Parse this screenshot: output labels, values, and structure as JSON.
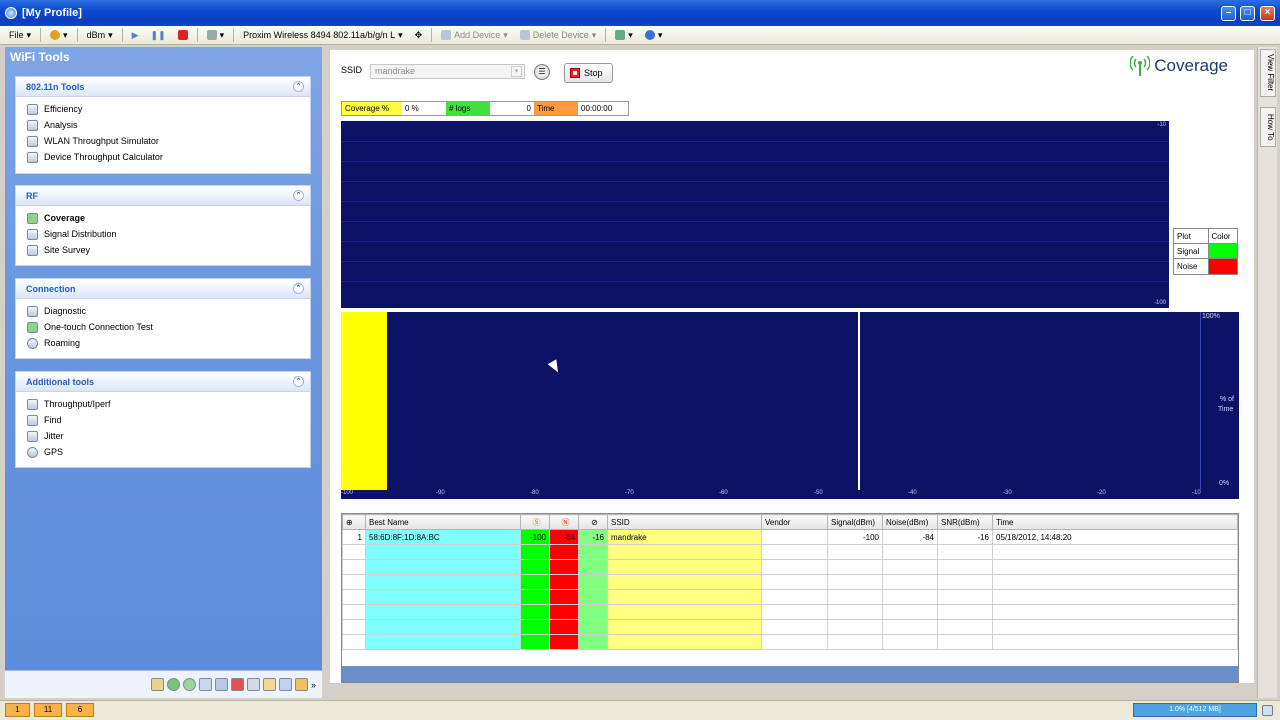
{
  "window": {
    "title": "[My Profile]"
  },
  "toolbar": {
    "file": "File",
    "unit": "dBm",
    "adapter": "Proxim Wireless 8494 802.11a/b/g/n L",
    "add_device": "Add Device",
    "delete_device": "Delete Device"
  },
  "leftpanel": {
    "title": "WiFi Tools",
    "groups": [
      {
        "title": "802.11n Tools",
        "items": [
          "Efficiency",
          "Analysis",
          "WLAN Throughput Simulator",
          "Device Throughput Calculator"
        ]
      },
      {
        "title": "RF",
        "items": [
          "Coverage",
          "Signal Distribution",
          "Site Survey"
        ]
      },
      {
        "title": "Connection",
        "items": [
          "Diagnostic",
          "One-touch Connection Test",
          "Roaming"
        ]
      },
      {
        "title": "Additional tools",
        "items": [
          "Throughput/Iperf",
          "Find",
          "Jitter",
          "GPS"
        ]
      }
    ]
  },
  "main": {
    "ssid_label": "SSID",
    "ssid_value": "mandrake",
    "stop_label": "Stop",
    "page_title": "Coverage",
    "status": {
      "coverage_label": "Coverage %",
      "coverage_value": "0 %",
      "logs_label": "# logs",
      "logs_value": "0",
      "time_label": "Time",
      "time_value": "00:00:00"
    },
    "plot1": {
      "y_top": "-10",
      "y_bottom": "-100"
    },
    "legend": {
      "header_plot": "Plot",
      "header_color": "Color",
      "rows": [
        {
          "name": "Signal",
          "color": "#00ff00"
        },
        {
          "name": "Noise",
          "color": "#ff0000"
        }
      ]
    },
    "plot2": {
      "x_ticks": [
        "-100",
        "-90",
        "-80",
        "-70",
        "-60",
        "-50",
        "-40",
        "-30",
        "-20",
        "-10"
      ],
      "y_top": "100%",
      "y_bottom": "0%",
      "y_label_line1": "% of",
      "y_label_line2": "Time"
    },
    "table": {
      "headers": [
        "Best Name",
        "SSID",
        "Vendor",
        "Signal(dBm)",
        "Noise(dBm)",
        "SNR(dBm)",
        "Time"
      ],
      "rows": [
        {
          "idx": "1",
          "name": "58:6D:8F:1D:8A:BC",
          "s": "-100",
          "n": "-84",
          "snr_short": "-16",
          "ssid": "mandrake",
          "vendor": "",
          "signal": "-100",
          "noise": "-84",
          "snr": "-16",
          "time": "05/18/2012, 14:48:20"
        }
      ]
    }
  },
  "righttabs": {
    "viewfilter": "View Filter",
    "howto": "How To"
  },
  "statusbar": {
    "b1": "1",
    "b2": "11",
    "b3": "6",
    "memory": "1.0% [4/512 MB]"
  }
}
